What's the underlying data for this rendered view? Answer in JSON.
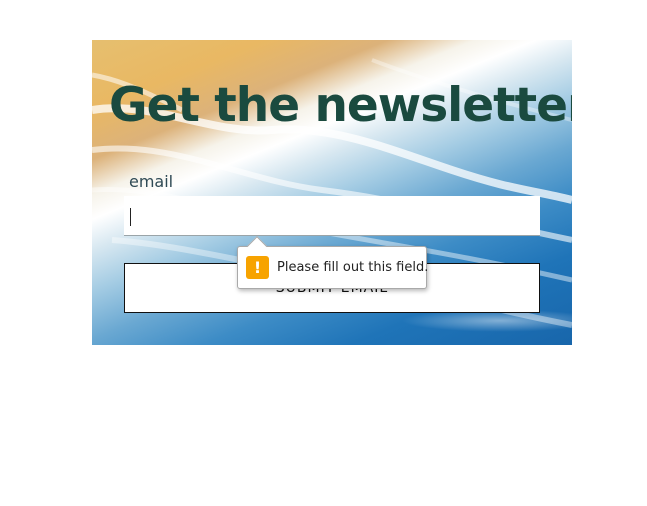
{
  "newsletter": {
    "title": "Get the newsletter!",
    "email_label": "email",
    "email_value": "",
    "submit_label": "SUBMIT EMAIL"
  },
  "validation": {
    "message": "Please fill out this field.",
    "icon": "warning-icon",
    "icon_glyph": "!",
    "icon_color": "#f7a300"
  },
  "colors": {
    "title": "#1a4a3f",
    "sand": "#e6bf6f",
    "ocean": "#1866ab"
  }
}
